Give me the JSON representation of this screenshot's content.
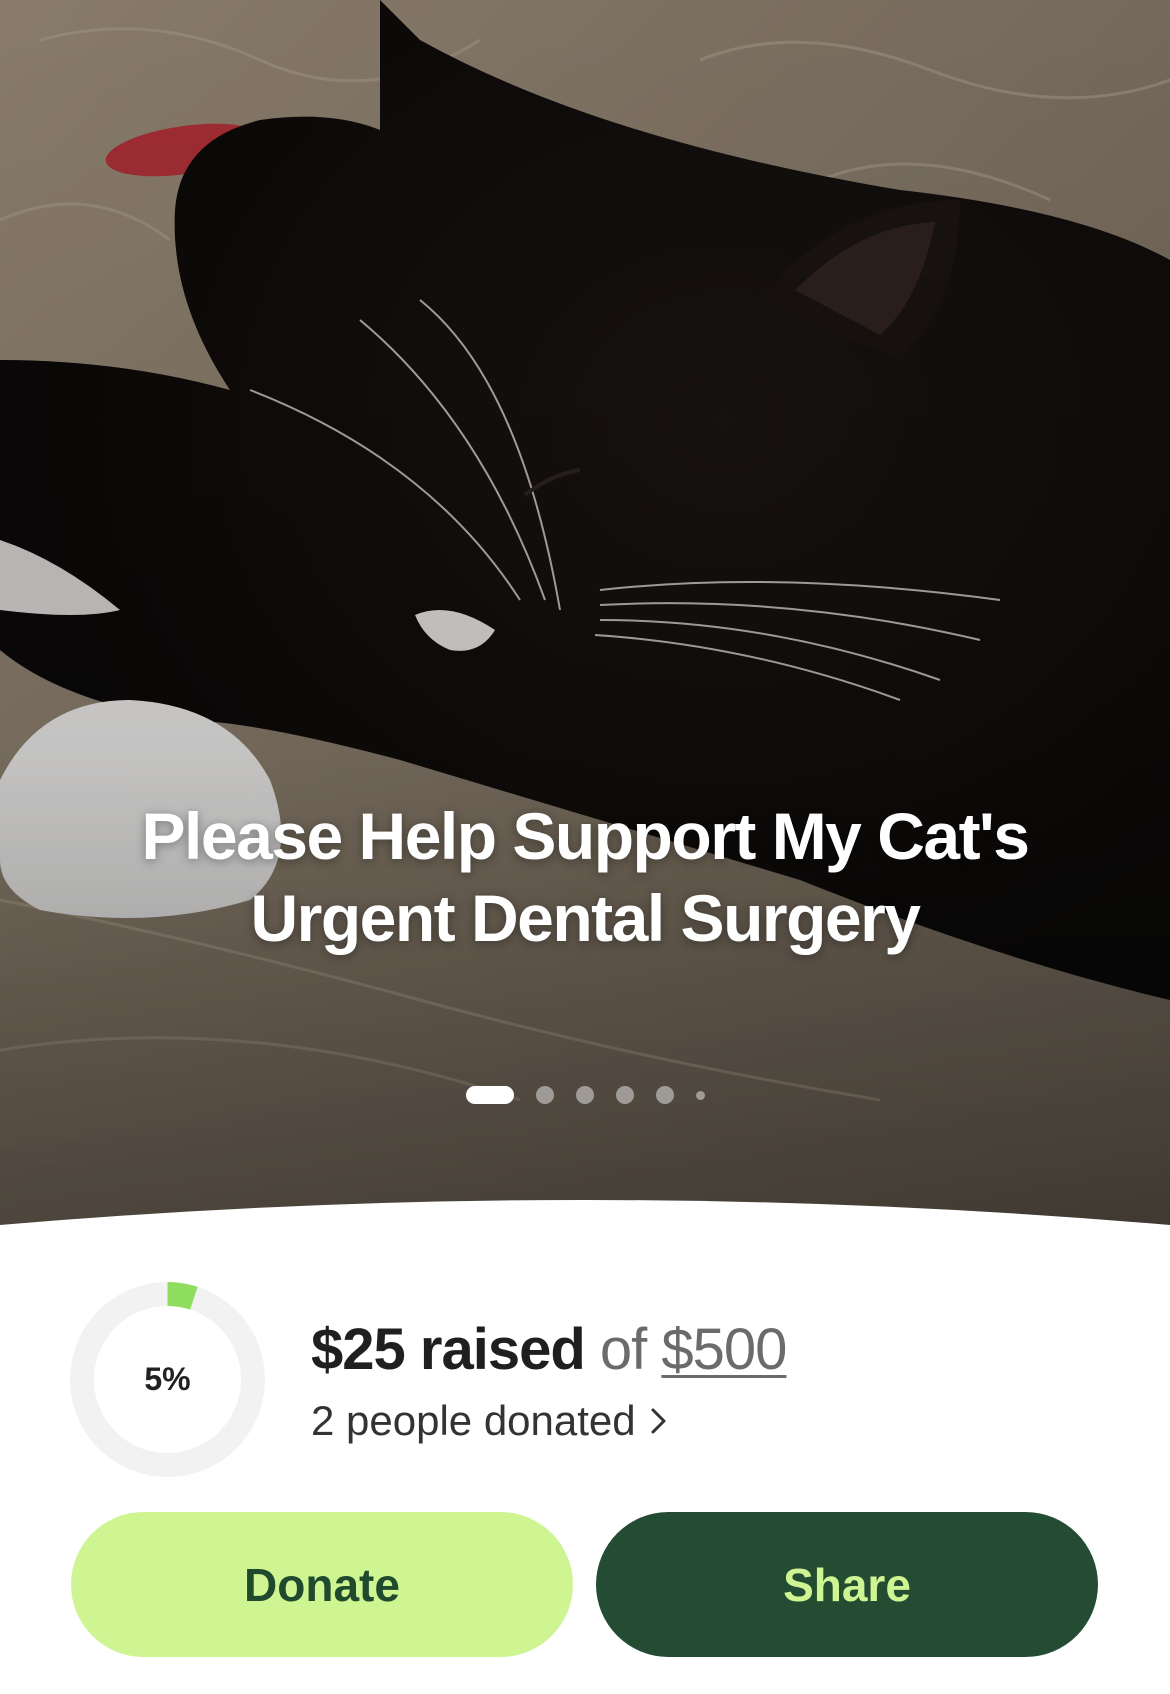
{
  "campaign": {
    "title": "Please Help Support My Cat's Urgent Dental Surgery",
    "photo": {
      "subject": "black-and-white-cat-photo",
      "slide_count": 6,
      "active_slide": 1
    }
  },
  "progress": {
    "percent_label": "5%",
    "fraction": 0.05,
    "raised_amount": "$25 raised",
    "of_label": "of",
    "goal_amount": "$500",
    "donors_text": "2 people donated",
    "donors_icon": "chevron-right-icon"
  },
  "actions": {
    "donate_label": "Donate",
    "share_label": "Share"
  },
  "colors": {
    "progress_fill": "#8fdd5e",
    "progress_track": "#f2f2f2",
    "donate_bg": "#cef591",
    "donate_text": "#1f4a2e",
    "share_bg": "#244c33",
    "share_text": "#cef591"
  }
}
